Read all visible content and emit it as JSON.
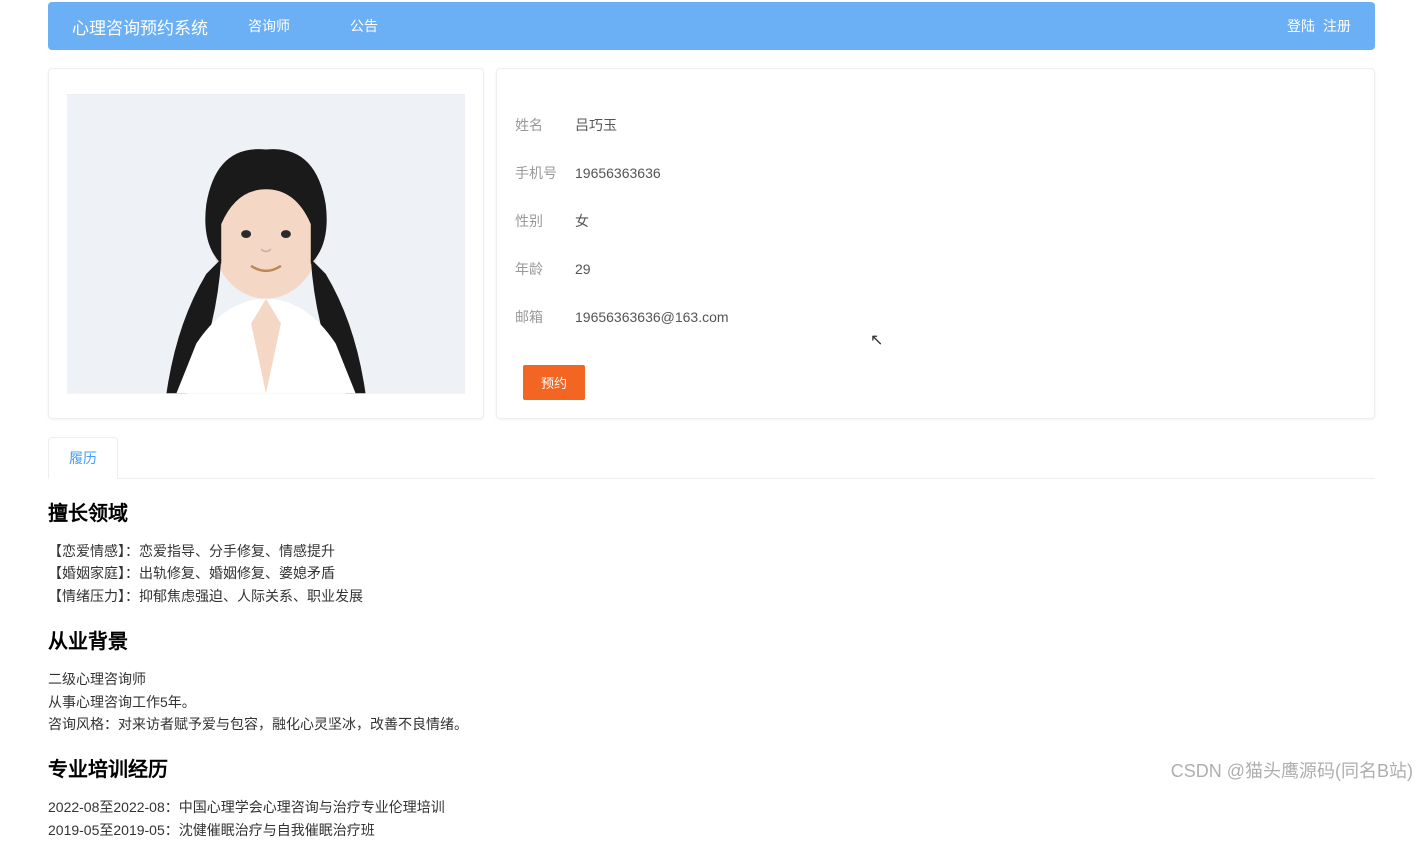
{
  "navbar": {
    "title": "心理咨询预约系统",
    "links": [
      "咨询师",
      "公告"
    ],
    "login": "登陆",
    "register": "注册"
  },
  "profile": {
    "fields": {
      "name_label": "姓名",
      "name_value": "吕巧玉",
      "phone_label": "手机号",
      "phone_value": "19656363636",
      "gender_label": "性别",
      "gender_value": "女",
      "age_label": "年龄",
      "age_value": "29",
      "email_label": "邮箱",
      "email_value": "19656363636@163.com"
    },
    "book_button": "预约"
  },
  "tabs": {
    "resume": "履历"
  },
  "resume": {
    "section1_title": "擅长领域",
    "section1_lines": [
      "【恋爱情感】：恋爱指导、分手修复、情感提升",
      "【婚姻家庭】：出轨修复、婚姻修复、婆媳矛盾",
      "【情绪压力】：抑郁焦虑强迫、人际关系、职业发展"
    ],
    "section2_title": "从业背景",
    "section2_lines": [
      "二级心理咨询师",
      "从事心理咨询工作5年。",
      "咨询风格：对来访者赋予爱与包容，融化心灵坚冰，改善不良情绪。"
    ],
    "section3_title": "专业培训经历",
    "section3_lines": [
      "2022-08至2022-08：中国心理学会心理咨询与治疗专业伦理培训",
      "2019-05至2019-05：沈健催眠治疗与自我催眠治疗班"
    ]
  },
  "watermark": "CSDN @猫头鹰源码(同名B站)"
}
